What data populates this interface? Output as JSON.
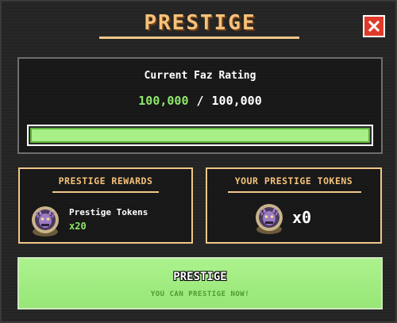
{
  "dialog": {
    "title": "PRESTIGE",
    "close_icon": "close-x-icon"
  },
  "rating": {
    "label": "Current Faz Rating",
    "current": "100,000",
    "separator": "/",
    "max": "100,000",
    "progress_fraction": 1.0
  },
  "rewards": {
    "title": "PRESTIGE REWARDS",
    "icon": "prestige-token-icon",
    "item_name": "Prestige Tokens",
    "item_quantity": "x20"
  },
  "tokens": {
    "title": "YOUR PRESTIGE TOKENS",
    "icon": "prestige-token-icon",
    "count": "x0"
  },
  "action": {
    "label": "PRESTIGE",
    "status": "YOU CAN PRESTIGE NOW!"
  },
  "colors": {
    "title": "#f6c27a",
    "accent_gold": "#f2c688",
    "success_green": "#8fe76b",
    "button_green": "#acf28d",
    "close_red": "#e03a2a"
  }
}
